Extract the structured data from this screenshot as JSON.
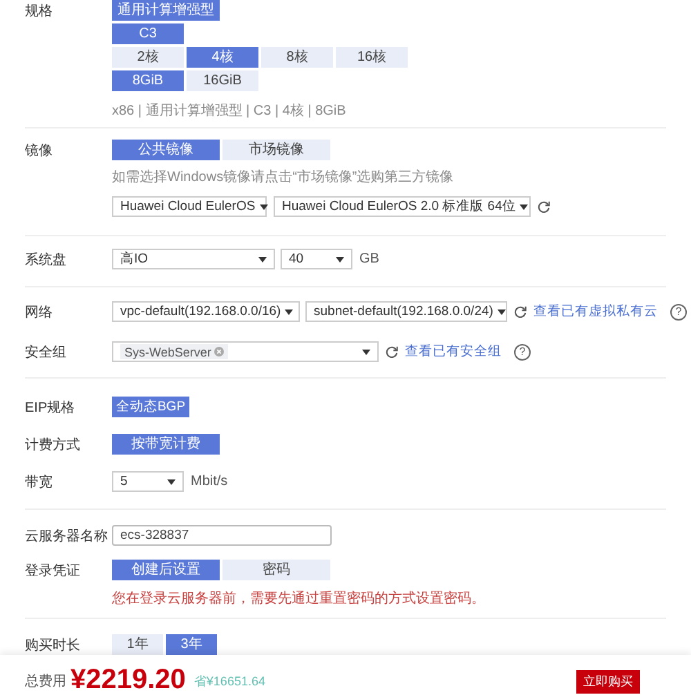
{
  "spec": {
    "label": "规格",
    "type_options": [
      {
        "label": "通用计算增强型",
        "selected": true
      }
    ],
    "series_options": [
      {
        "label": "C3",
        "selected": true
      }
    ],
    "cpu_options": [
      {
        "label": "2核",
        "selected": false
      },
      {
        "label": "4核",
        "selected": true
      },
      {
        "label": "8核",
        "selected": false
      },
      {
        "label": "16核",
        "selected": false
      }
    ],
    "memory_options": [
      {
        "label": "8GiB",
        "selected": true
      },
      {
        "label": "16GiB",
        "selected": false
      }
    ],
    "summary": "x86 | 通用计算增强型 | C3 | 4核 | 8GiB"
  },
  "image": {
    "label": "镜像",
    "options": [
      {
        "label": "公共镜像",
        "selected": true
      },
      {
        "label": "市场镜像",
        "selected": false
      }
    ],
    "hint": "如需选择Windows镜像请点击“市场镜像”选购第三方镜像",
    "os_select": "Huawei Cloud EulerOS",
    "version_select": "Huawei Cloud EulerOS 2.0 标准版 64位"
  },
  "system_disk": {
    "label": "系统盘",
    "type_select": "高IO",
    "size_select": "40",
    "unit": "GB"
  },
  "network": {
    "label": "网络",
    "vpc_select": "vpc-default(192.168.0.0/16)",
    "subnet_select": "subnet-default(192.168.0.0/24)",
    "link": "查看已有虚拟私有云",
    "help": "?"
  },
  "security_group": {
    "label": "安全组",
    "tag": "Sys-WebServer",
    "link": "查看已有安全组",
    "help": "?"
  },
  "eip": {
    "label": "EIP规格",
    "options": [
      {
        "label": "全动态BGP",
        "selected": true
      }
    ]
  },
  "billing": {
    "label": "计费方式",
    "options": [
      {
        "label": "按带宽计费",
        "selected": true
      }
    ]
  },
  "bandwidth": {
    "label": "带宽",
    "select": "5",
    "unit": "Mbit/s"
  },
  "server_name": {
    "label": "云服务器名称",
    "value": "ecs-328837"
  },
  "login": {
    "label": "登录凭证",
    "options": [
      {
        "label": "创建后设置",
        "selected": true
      },
      {
        "label": "密码",
        "selected": false
      }
    ],
    "warning": "您在登录云服务器前，需要先通过重置密码的方式设置密码。"
  },
  "duration": {
    "label": "购买时长",
    "options": [
      {
        "label": "1年",
        "selected": false
      },
      {
        "label": "3年",
        "selected": true
      }
    ]
  },
  "footer": {
    "total_label": "总费用",
    "price": "¥2219.20",
    "saving": "省¥16651.64",
    "buy_button": "立即购买"
  }
}
